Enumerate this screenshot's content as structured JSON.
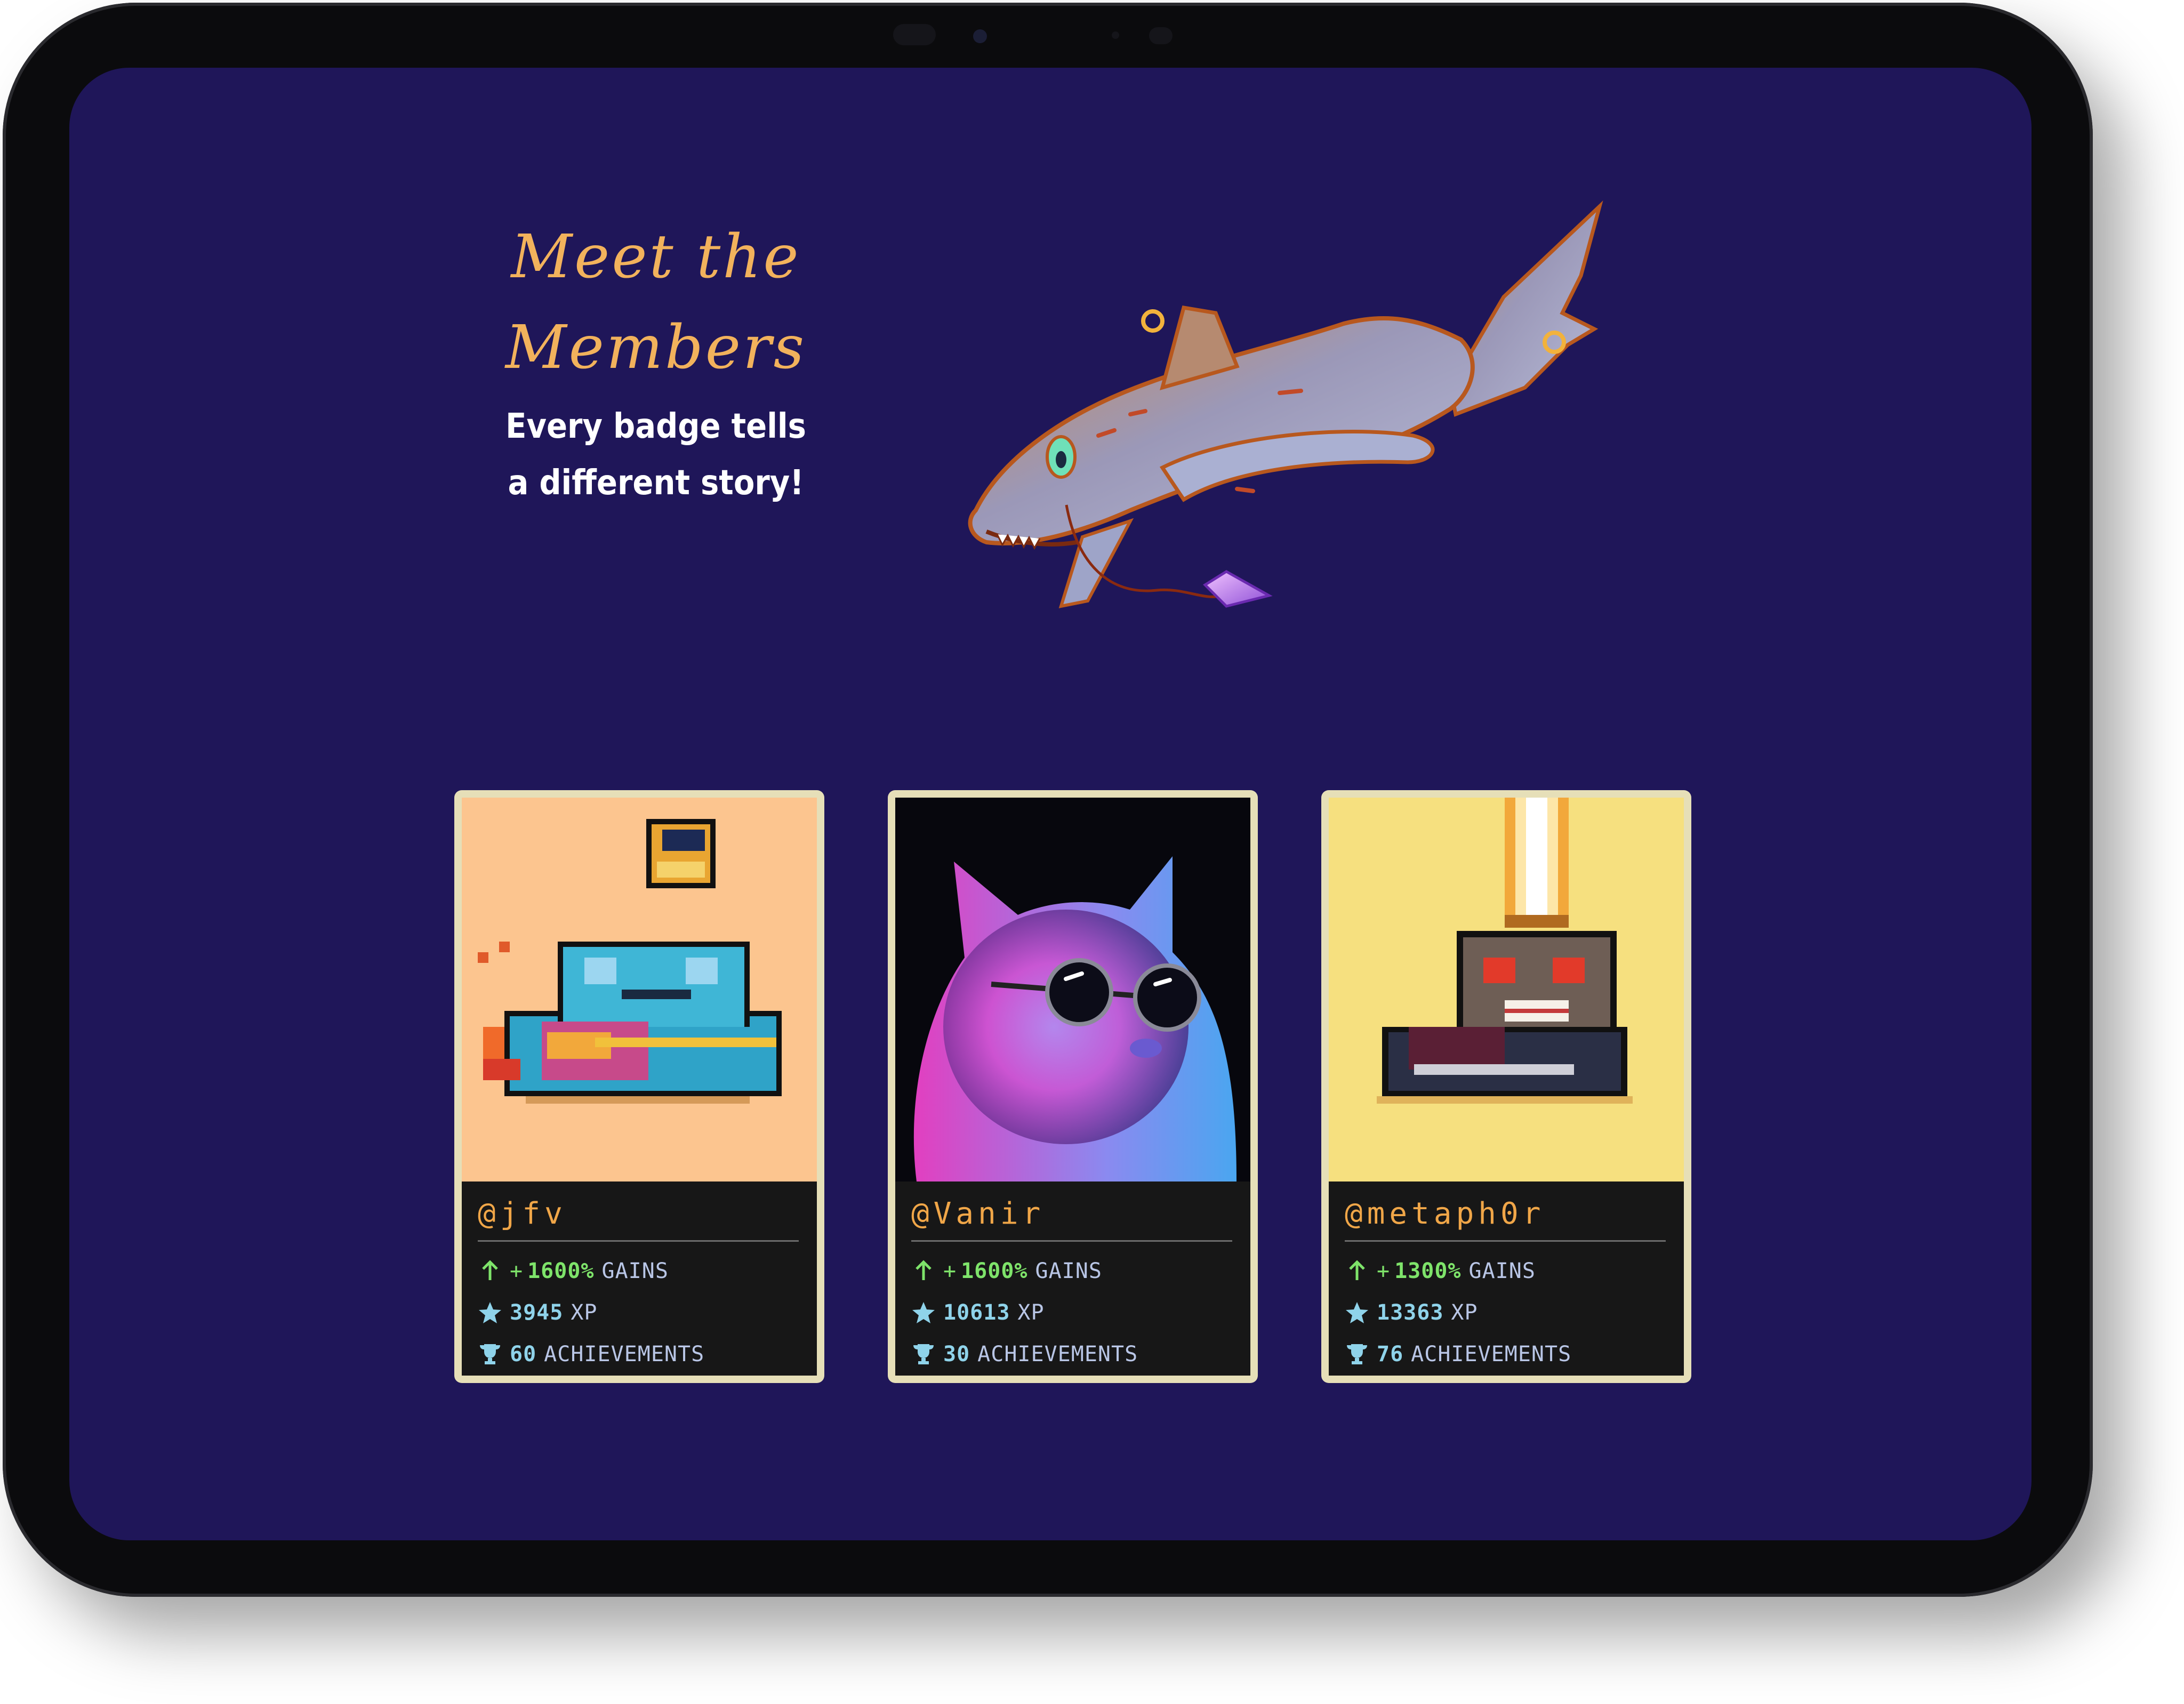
{
  "hero": {
    "title_line1": "Meet the",
    "title_line2": "Members",
    "subtitle_line1": "Every badge tells",
    "subtitle_line2": "a different story!"
  },
  "members": [
    {
      "handle": "@jfv",
      "art": "pixel-frog-icon",
      "art_bg": "#fcc58f",
      "gains_prefix": "+",
      "gains_value": "1600%",
      "gains_label": "GAINS",
      "xp_value": "3945",
      "xp_label": "XP",
      "achievements_value": "60",
      "achievements_label": "ACHIEVEMENTS"
    },
    {
      "handle": "@Vanir",
      "art": "cat-with-sunglasses-image",
      "art_bg": "#0a0a12",
      "gains_prefix": "+",
      "gains_value": "1600%",
      "gains_label": "GAINS",
      "xp_value": "10613",
      "xp_label": "XP",
      "achievements_value": "30",
      "achievements_label": "ACHIEVEMENTS"
    },
    {
      "handle": "@metaph0r",
      "art": "pixel-mole-icon",
      "art_bg": "#f6e07f",
      "gains_prefix": "+",
      "gains_value": "1300%",
      "gains_label": "GAINS",
      "xp_value": "13363",
      "xp_label": "XP",
      "achievements_value": "76",
      "achievements_label": "ACHIEVEMENTS"
    }
  ],
  "colors": {
    "screen_bg": "#1f1659",
    "title": "#f2b25c",
    "handle": "#f0a648",
    "gain": "#7ee36a",
    "stat": "#8fd3ea",
    "card_frame": "#e6dfb8",
    "card_info_bg": "#171717"
  }
}
